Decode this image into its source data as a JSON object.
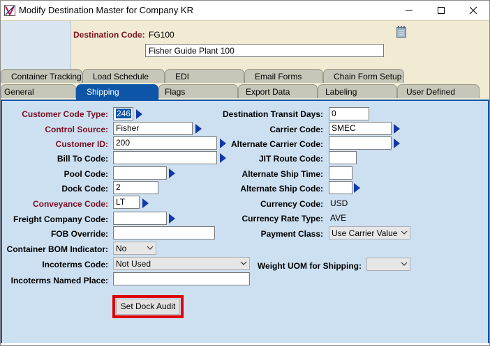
{
  "window": {
    "title": "Modify Destination Master for Company KR"
  },
  "header": {
    "dest_code_label": "Destination Code:",
    "dest_code_value": "FG100",
    "dest_name_value": "Fisher Guide Plant 100"
  },
  "tabs_row1": [
    {
      "label": "Container Tracking"
    },
    {
      "label": "Load Schedule"
    },
    {
      "label": "EDI"
    },
    {
      "label": "Email Forms"
    },
    {
      "label": "Chain Form Setup"
    }
  ],
  "tabs_row2": [
    {
      "label": "General"
    },
    {
      "label": "Shipping"
    },
    {
      "label": "Flags"
    },
    {
      "label": "Export Data"
    },
    {
      "label": "Labeling"
    },
    {
      "label": "User Defined"
    }
  ],
  "left": {
    "customer_code_type": {
      "label": "Customer Code Type:",
      "value": "246"
    },
    "control_source": {
      "label": "Control Source:",
      "value": "Fisher"
    },
    "customer_id": {
      "label": "Customer ID:",
      "value": "200"
    },
    "bill_to_code": {
      "label": "Bill To Code:",
      "value": ""
    },
    "pool_code": {
      "label": "Pool Code:",
      "value": ""
    },
    "dock_code": {
      "label": "Dock Code:",
      "value": "2"
    },
    "conveyance_code": {
      "label": "Conveyance Code:",
      "value": "LT"
    },
    "freight_company_code": {
      "label": "Freight Company Code:",
      "value": ""
    },
    "fob_override": {
      "label": "FOB Override:",
      "value": ""
    },
    "container_bom_indicator": {
      "label": "Container BOM Indicator:",
      "value": "No"
    },
    "incoterms_code": {
      "label": "Incoterms Code:",
      "value": "Not Used"
    },
    "incoterms_named_place": {
      "label": "Incoterms Named Place:",
      "value": ""
    }
  },
  "right": {
    "destination_transit_days": {
      "label": "Destination Transit Days:",
      "value": "0"
    },
    "carrier_code": {
      "label": "Carrier Code:",
      "value": "SMEC"
    },
    "alternate_carrier_code": {
      "label": "Alternate Carrier Code:",
      "value": ""
    },
    "jit_route_code": {
      "label": "JIT Route Code:",
      "value": ""
    },
    "alternate_ship_time": {
      "label": "Alternate Ship Time:",
      "value": ""
    },
    "alternate_ship_code": {
      "label": "Alternate Ship Code:",
      "value": ""
    },
    "currency_code": {
      "label": "Currency Code:",
      "value": "USD"
    },
    "currency_rate_type": {
      "label": "Currency Rate Type:",
      "value": "AVE"
    },
    "payment_class": {
      "label": "Payment Class:",
      "value": "Use Carrier Value"
    },
    "weight_uom": {
      "label": "Weight UOM for Shipping:",
      "value": ""
    }
  },
  "buttons": {
    "set_dock_audit": "Set Dock Audit"
  },
  "colors": {
    "accent": "#0c55a7",
    "required_label": "#7a1020",
    "highlight_box": "#e00000",
    "content_bg": "#cde0f2",
    "header_bg": "#f0ebd2"
  }
}
